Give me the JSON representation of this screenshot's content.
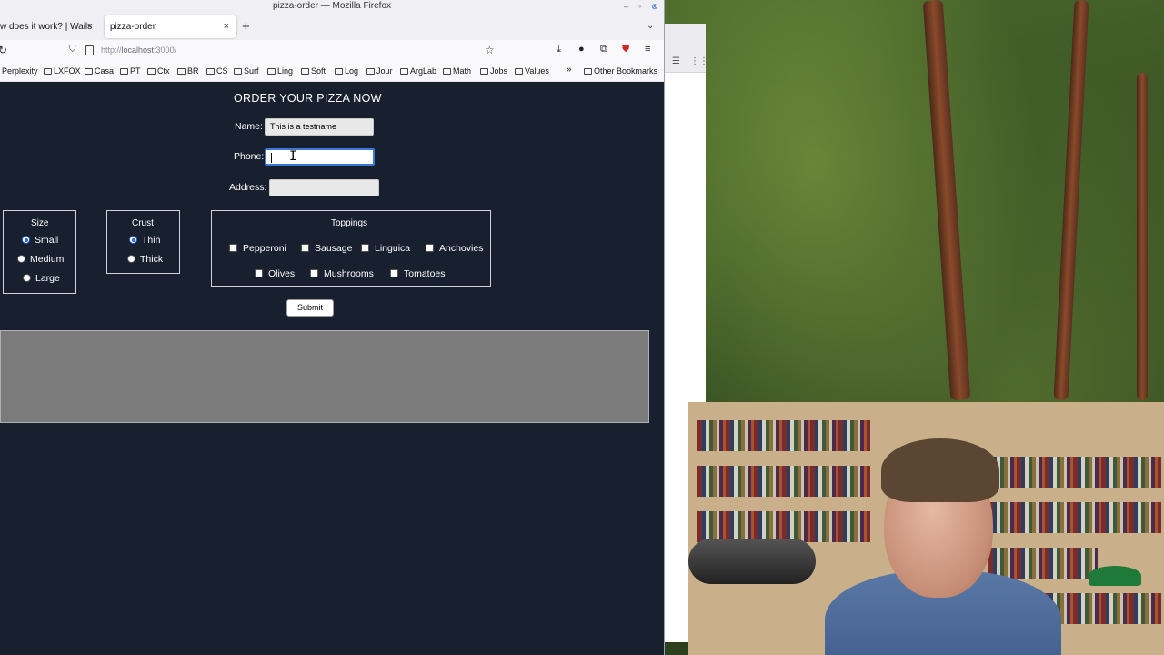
{
  "window": {
    "title": "pizza-order — Mozilla Firefox"
  },
  "tabs": [
    {
      "label": "w does it work? | Wails",
      "active": false
    },
    {
      "label": "pizza-order",
      "active": true
    }
  ],
  "navbar": {
    "url_prefix": "http://",
    "url_host": "localhost",
    "url_suffix": ":3000/"
  },
  "bookmarks": [
    "Perplexity",
    "LXFOX",
    "Casa",
    "PT",
    "Ctx",
    "BR",
    "CS",
    "Surf",
    "Ling",
    "Soft",
    "Log",
    "Jour",
    "ArgLab",
    "Math",
    "Jobs",
    "Values"
  ],
  "bookmarks_overflow": "»",
  "other_bookmarks": "Other Bookmarks",
  "form": {
    "heading": "ORDER YOUR PIZZA NOW",
    "name_label": "Name:",
    "name_value": "This is a testname",
    "phone_label": "Phone:",
    "phone_value": "",
    "address_label": "Address:",
    "address_value": "",
    "size": {
      "legend": "Size",
      "options": [
        "Small",
        "Medium",
        "Large"
      ],
      "selected": "Small"
    },
    "crust": {
      "legend": "Crust",
      "options": [
        "Thin",
        "Thick"
      ],
      "selected": "Thin"
    },
    "toppings": {
      "legend": "Toppings",
      "row1": [
        "Pepperoni",
        "Sausage",
        "Linguica",
        "Anchovies"
      ],
      "row2": [
        "Olives",
        "Mushrooms",
        "Tomatoes"
      ]
    },
    "submit_label": "Submit"
  },
  "colors": {
    "page_bg": "#18202f",
    "output_bg": "#7b7b7b",
    "focus_ring": "#3b78d6",
    "radio_accent": "#2e64d6"
  }
}
